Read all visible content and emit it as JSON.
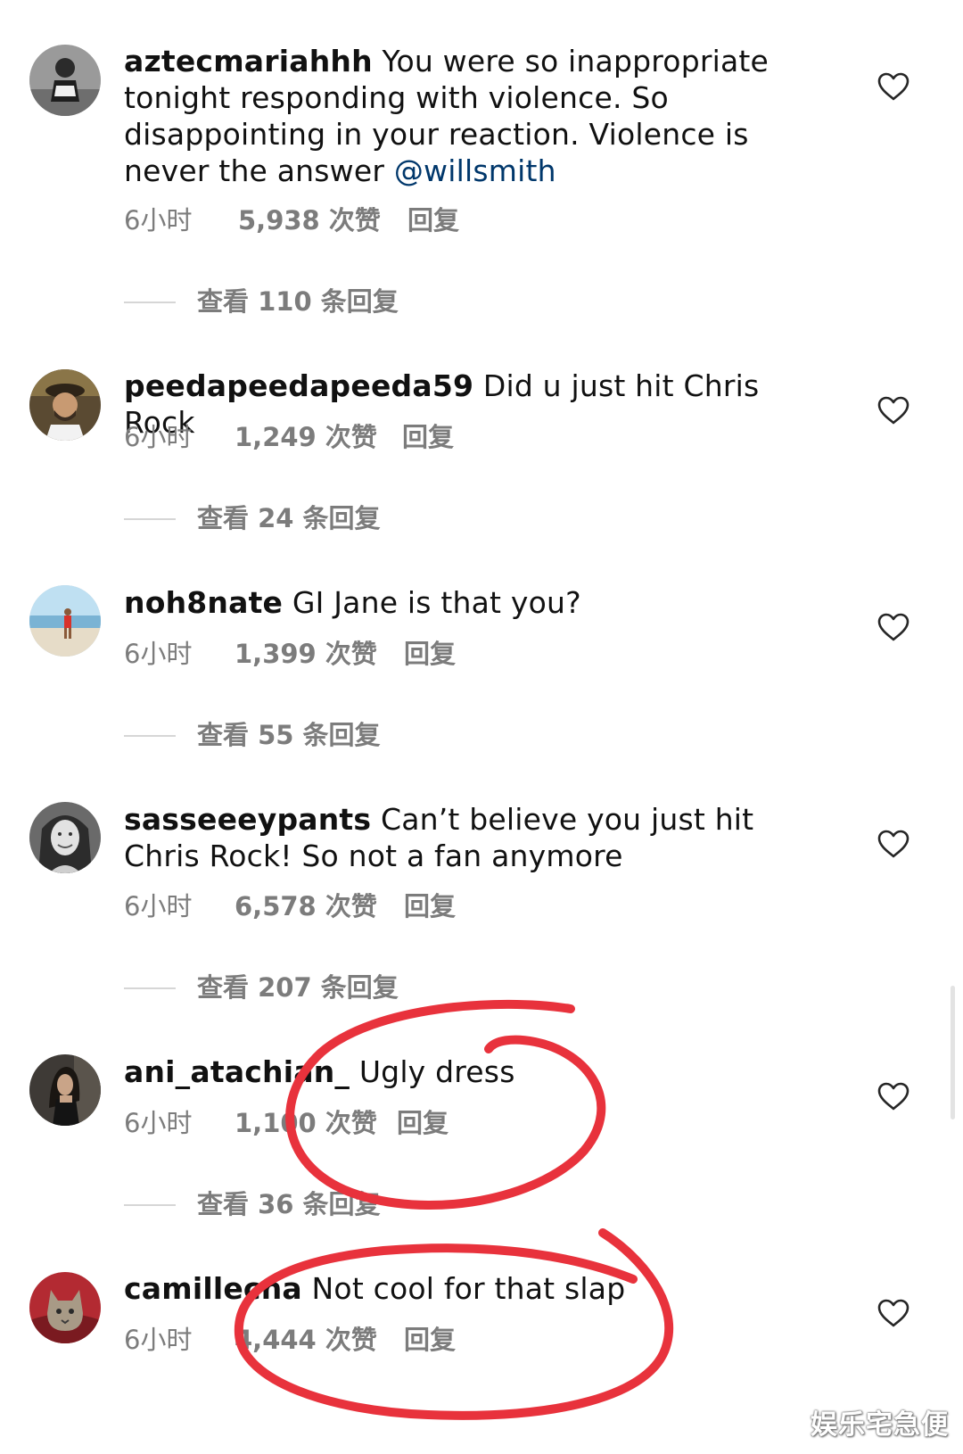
{
  "comments": [
    {
      "username": "aztecmariahhh",
      "text": " You were so inappropriate tonight responding with violence. So disappointing in your reaction. Violence is never the answer ",
      "mention": "@willsmith",
      "time": "6小时",
      "likes": "5,938 次赞",
      "reply": "回复",
      "view_replies": "查看 110 条回复"
    },
    {
      "username": "peedapeedapeeda59",
      "text": " Did u just hit Chris Rock",
      "time": "6小时",
      "likes": "1,249 次赞",
      "reply": "回复",
      "view_replies": "查看 24 条回复"
    },
    {
      "username": "noh8nate",
      "text": " GI Jane is that you?",
      "time": "6小时",
      "likes": "1,399 次赞",
      "reply": "回复",
      "view_replies": "查看 55 条回复"
    },
    {
      "username": "sasseeeypants",
      "text": " Can’t believe you just hit Chris Rock! So not a fan anymore",
      "time": "6小时",
      "likes": "6,578 次赞",
      "reply": "回复",
      "view_replies": "查看 207 条回复"
    },
    {
      "username": "ani_atachian_",
      "text": " Ugly dress",
      "time": "6小时",
      "likes": "1,100 次赞",
      "reply": "回复",
      "view_replies": "查看 36 条回复"
    },
    {
      "username": "camillecna",
      "text": " Not cool for that slap",
      "time": "6小时",
      "likes": "4,444 次赞",
      "reply": "回复"
    }
  ],
  "annotation_color": "#e8323c",
  "like_icon": "heart-outline-icon",
  "watermark": "娱乐宅急便"
}
